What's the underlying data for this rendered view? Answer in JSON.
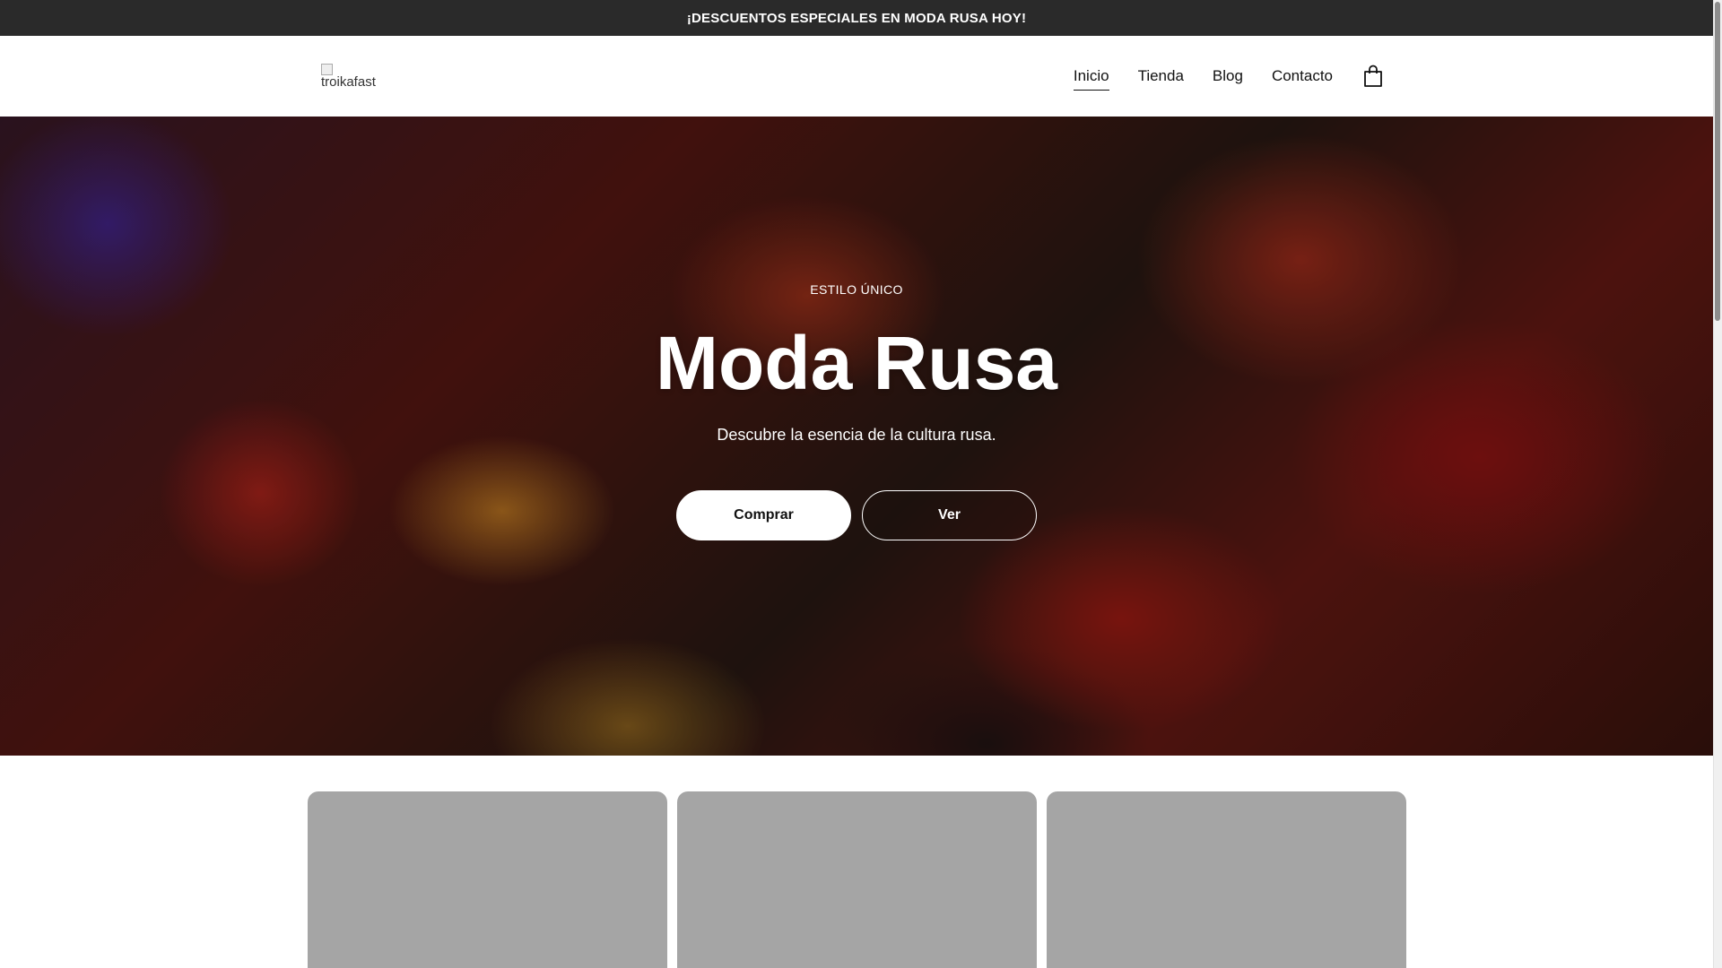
{
  "announcement": {
    "text": "¡DESCUENTOS ESPECIALES EN MODA RUSA HOY!"
  },
  "header": {
    "logo_alt": "troikafast",
    "nav": [
      {
        "label": "Inicio",
        "active": true
      },
      {
        "label": "Tienda",
        "active": false
      },
      {
        "label": "Blog",
        "active": false
      },
      {
        "label": "Contacto",
        "active": false
      }
    ],
    "cart_icon": "shopping-bag-icon"
  },
  "hero": {
    "eyebrow": "ESTILO ÚNICO",
    "title": "Moda Rusa",
    "subtitle": "Descubre la esencia de la cultura rusa.",
    "primary_button": "Comprar",
    "secondary_button": "Ver"
  },
  "cards": [
    {
      "placeholder_color": "#a5a5a5"
    },
    {
      "placeholder_color": "#a5a5a5"
    },
    {
      "placeholder_color": "#a5a5a5"
    }
  ],
  "colors": {
    "announcement_bg": "#2a2a2a",
    "card_placeholder": "#a5a5a5",
    "button_primary_bg": "#ffffff"
  }
}
